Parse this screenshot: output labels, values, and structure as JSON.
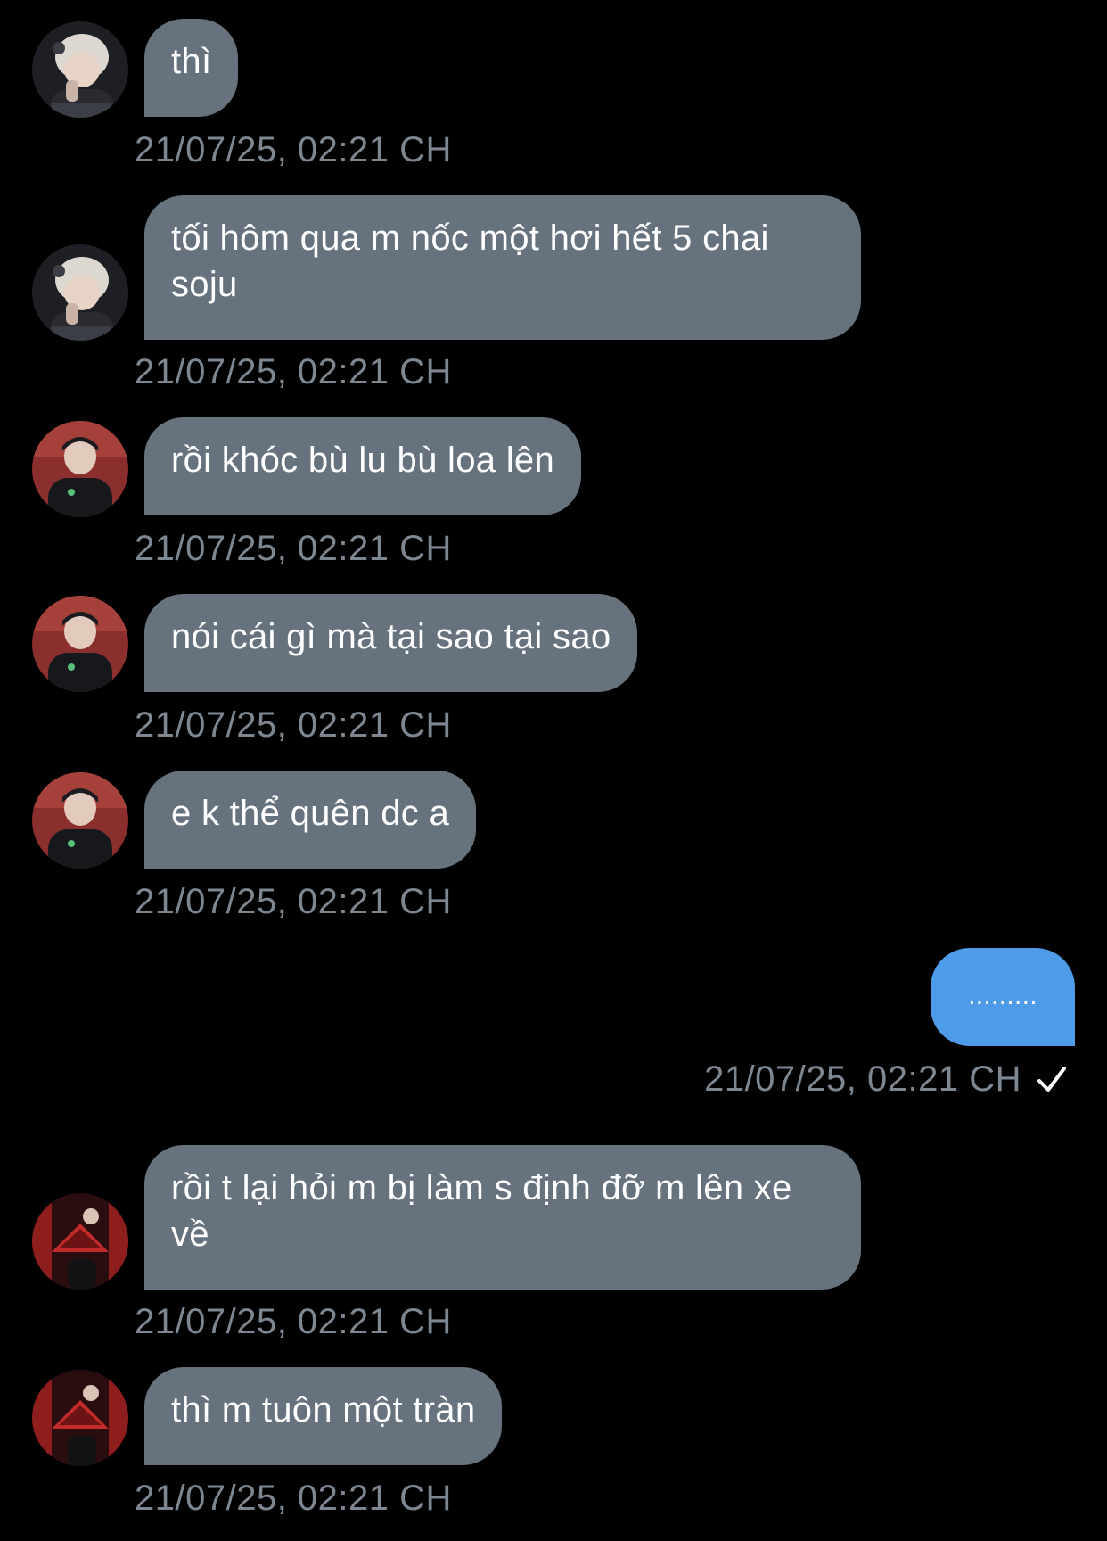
{
  "messages": [
    {
      "text": "thì",
      "time": "21/07/25, 02:21 CH",
      "avatar": "avatar-a-icon"
    },
    {
      "text": "tối hôm qua m nốc một hơi hết 5 chai soju",
      "time": "21/07/25, 02:21 CH",
      "avatar": "avatar-a-icon"
    },
    {
      "text": "rồi khóc bù lu bù loa lên",
      "time": "21/07/25, 02:21 CH",
      "avatar": "avatar-b-icon"
    },
    {
      "text": "nói cái gì mà tại sao tại sao",
      "time": "21/07/25, 02:21 CH",
      "avatar": "avatar-b-icon"
    },
    {
      "text": "e k thể quên dc a",
      "time": "21/07/25, 02:21 CH",
      "avatar": "avatar-b-icon"
    },
    {
      "text": ".........",
      "time": "21/07/25, 02:21 CH",
      "outgoing": true,
      "status_icon": "checkmark-icon"
    },
    {
      "text": "rồi t lại hỏi m bị làm s định đỡ m lên xe về",
      "time": "21/07/25, 02:21 CH",
      "avatar": "avatar-c-icon"
    },
    {
      "text": "thì m tuôn một tràn",
      "time": "21/07/25, 02:21 CH",
      "avatar": "avatar-c-icon"
    }
  ],
  "colors": {
    "background": "#000000",
    "incoming_bubble": "#66727e",
    "outgoing_bubble": "#4e9be9",
    "timestamp": "#7d8792",
    "text": "#ffffff"
  }
}
